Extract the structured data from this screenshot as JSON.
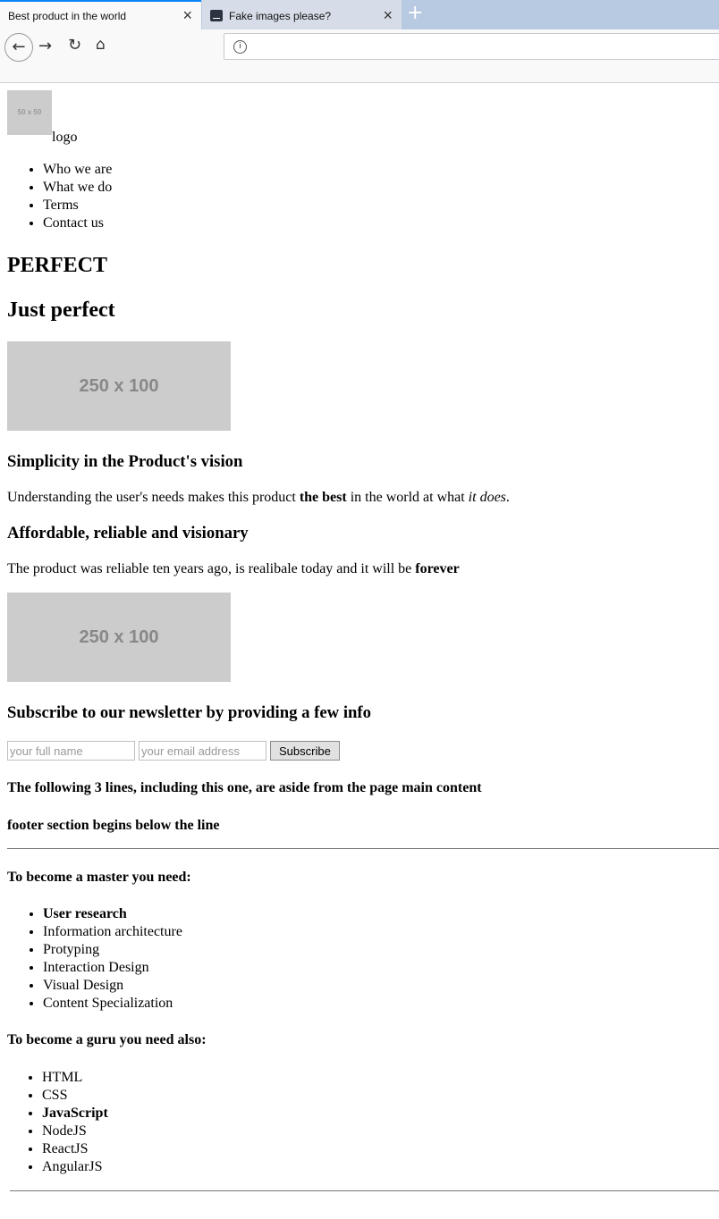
{
  "browser": {
    "tabs": [
      {
        "label": "Best product in the world",
        "active": true
      },
      {
        "label": "Fake images please?",
        "active": false
      }
    ],
    "new_tab_icon": "plus-icon",
    "nav_icons": [
      "back-arrow-icon",
      "forward-arrow-icon",
      "reload-icon",
      "home-icon"
    ],
    "address_value": ""
  },
  "header": {
    "logo_placeholder": "50 x 50",
    "logo_text": "logo",
    "nav": [
      "Who we are",
      "What we do",
      "Terms",
      "Contact us"
    ]
  },
  "main": {
    "title": "PERFECT",
    "subtitle": "Just perfect",
    "banner_placeholder": "250 x 100",
    "section1": {
      "heading": "Simplicity in the Product's vision",
      "text_before": "Understanding the user's needs makes this product ",
      "text_bold": "the best",
      "text_middle": " in the world at what ",
      "text_italic": "it does",
      "text_after": "."
    },
    "section2": {
      "heading": "Affordable, reliable and visionary",
      "text_before": "The product was reliable ten years ago, is realibale today and it will be ",
      "text_bold": "forever"
    },
    "banner2_placeholder": "250 x 100",
    "newsletter": {
      "heading": "Subscribe to our newsletter by providing a few info",
      "name_placeholder": "your full name",
      "email_placeholder": "your email address",
      "subscribe_label": "Subscribe"
    }
  },
  "aside": {
    "line1": "The following 3 lines, including this one, are aside from the page main content",
    "line2": "footer section begins below the line"
  },
  "footer": {
    "master_heading": "To become a master you need:",
    "master_items": [
      "User research",
      "Information architecture",
      "Protyping",
      "Interaction Design",
      "Visual Design",
      "Content Specialization"
    ],
    "guru_heading": "To become a guru you need also:",
    "guru_items": [
      "HTML",
      "CSS",
      "JavaScript",
      "NodeJS",
      "ReactJS",
      "AngularJS"
    ]
  }
}
